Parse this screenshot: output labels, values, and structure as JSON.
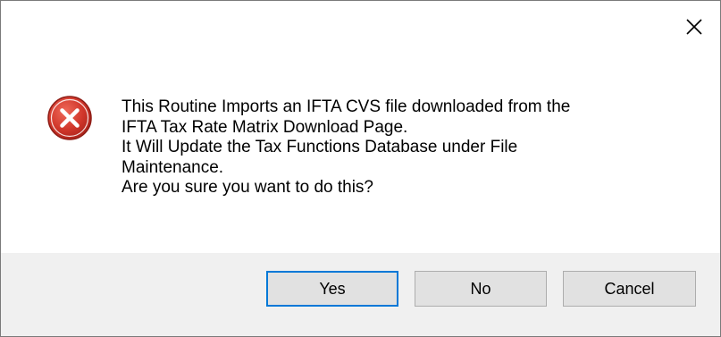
{
  "dialog": {
    "message_lines": [
      "This Routine Imports an IFTA CVS file downloaded from the",
      "IFTA Tax Rate Matrix Download Page.",
      "It Will Update the Tax Functions Database under File",
      "Maintenance.",
      "Are you sure you want to do this?"
    ],
    "icon": "error-icon",
    "colors": {
      "error_red": "#c42b1c",
      "focus_blue": "#0078d7",
      "footer_bg": "#f0f0f0"
    }
  },
  "buttons": {
    "yes_label": "Yes",
    "no_label": "No",
    "cancel_label": "Cancel"
  },
  "titlebar": {
    "close_icon": "close-icon"
  }
}
